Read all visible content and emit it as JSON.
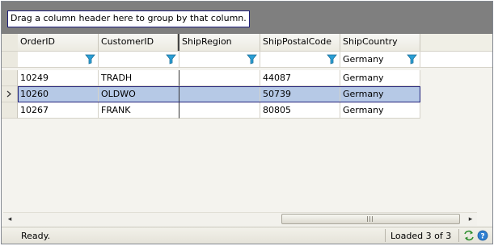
{
  "group_panel": {
    "hint": "Drag a column header here to group by that column."
  },
  "columns": [
    "OrderID",
    "CustomerID",
    "ShipRegion",
    "ShipPostalCode",
    "ShipCountry"
  ],
  "filter_row": {
    "ShipCountry": "Germany"
  },
  "rows": [
    {
      "OrderID": "10249",
      "CustomerID": "TRADH",
      "ShipRegion": "",
      "ShipPostalCode": "44087",
      "ShipCountry": "Germany",
      "selected": false
    },
    {
      "OrderID": "10260",
      "CustomerID": "OLDWO",
      "ShipRegion": "",
      "ShipPostalCode": "50739",
      "ShipCountry": "Germany",
      "selected": true
    },
    {
      "OrderID": "10267",
      "CustomerID": "FRANK",
      "ShipRegion": "",
      "ShipPostalCode": "80805",
      "ShipCountry": "Germany",
      "selected": false
    }
  ],
  "scrollbar": {
    "left_arrow": "◂",
    "right_arrow": "▸"
  },
  "statusbar": {
    "status": "Ready.",
    "loaded": "Loaded 3 of 3",
    "icons": [
      "refresh-arrows-icon",
      "help-icon"
    ]
  },
  "colors": {
    "selection": "#b6c9e6",
    "group_panel": "#7f7f7f",
    "funnel": "#2a9fd6"
  }
}
